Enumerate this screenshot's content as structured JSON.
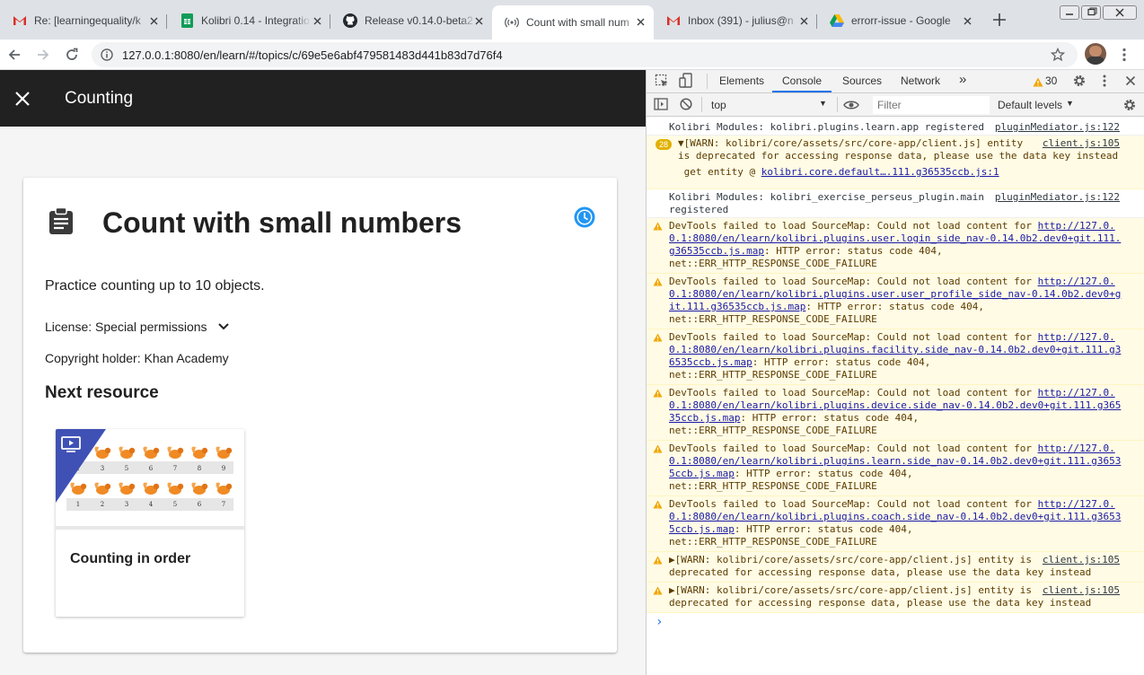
{
  "browser": {
    "tabs": [
      {
        "title": "Re: [learningequality/k",
        "icon": "gmail-icon"
      },
      {
        "title": "Kolibri 0.14 - Integratio",
        "icon": "sheets-icon"
      },
      {
        "title": "Release v0.14.0-beta2",
        "icon": "github-icon"
      },
      {
        "title": "Count with small num",
        "icon": "podcast-icon",
        "active": true
      },
      {
        "title": "Inbox (391) - julius@n",
        "icon": "gmail-icon"
      },
      {
        "title": "errorr-issue - Google",
        "icon": "drive-icon"
      }
    ],
    "url": "127.0.0.1:8080/en/learn/#/topics/c/69e5e6abf479581483d441b83d7d76f4"
  },
  "app": {
    "header_title": "Counting",
    "content_title": "Count with small numbers",
    "description": "Practice counting up to 10 objects.",
    "license": "License: Special permissions",
    "copyright": "Copyright holder: Khan Academy",
    "next_heading": "Next resource",
    "next_resource_title": "Counting in order",
    "thumb_row1": [
      "1",
      "3",
      "5",
      "6",
      "7",
      "8",
      "9"
    ],
    "thumb_row2": [
      "1",
      "2",
      "3",
      "4",
      "5",
      "6",
      "7"
    ],
    "accent": "#2196f3",
    "appbar_color": "#212121"
  },
  "devtools": {
    "tabs": [
      "Elements",
      "Console",
      "Sources",
      "Network"
    ],
    "more": "»",
    "warn_count": "30",
    "context": "top",
    "filter_placeholder": "Filter",
    "levels": "Default levels",
    "messages": [
      {
        "type": "log",
        "text": "Kolibri Modules: kolibri.plugins.learn.app registered",
        "src": "pluginMediator.js:122"
      },
      {
        "type": "warn",
        "badge": "28",
        "line1": "▼[WARN: kolibri/core/assets/src/core-app/client.js] entity",
        "line2": "is deprecated for accessing response data, please use the data key instead",
        "line3a": " get entity @ ",
        "line3b": "kolibri.core.default….111.g36535ccb.js:1",
        "src": "client.js:105"
      },
      {
        "type": "log",
        "text": "Kolibri Modules: kolibri_exercise_perseus_plugin.main\nregistered",
        "src": "pluginMediator.js:122"
      },
      {
        "type": "warn",
        "line1a": "DevTools failed to load SourceMap: Could not load content for ",
        "line1b": "http://127.0.",
        "line2": "0.1:8080/en/learn/kolibri.plugins.user.login_side_nav-0.14.0b2.dev0+git.111.",
        "line3a": "g36535ccb.js.map",
        "line3b": ": HTTP error: status code 404,",
        "line4": "net::ERR_HTTP_RESPONSE_CODE_FAILURE"
      },
      {
        "type": "warn",
        "line1a": "DevTools failed to load SourceMap: Could not load content for ",
        "line1b": "http://127.0.",
        "line2": "0.1:8080/en/learn/kolibri.plugins.user.user_profile_side_nav-0.14.0b2.dev0+g",
        "line3a": "it.111.g36535ccb.js.map",
        "line3b": ": HTTP error: status code 404,",
        "line4": "net::ERR_HTTP_RESPONSE_CODE_FAILURE"
      },
      {
        "type": "warn",
        "line1a": "DevTools failed to load SourceMap: Could not load content for ",
        "line1b": "http://127.0.",
        "line2": "0.1:8080/en/learn/kolibri.plugins.facility.side_nav-0.14.0b2.dev0+git.111.g3",
        "line3a": "6535ccb.js.map",
        "line3b": ": HTTP error: status code 404,",
        "line4": "net::ERR_HTTP_RESPONSE_CODE_FAILURE"
      },
      {
        "type": "warn",
        "line1a": "DevTools failed to load SourceMap: Could not load content for ",
        "line1b": "http://127.0.",
        "line2": "0.1:8080/en/learn/kolibri.plugins.device.side_nav-0.14.0b2.dev0+git.111.g365",
        "line3a": "35ccb.js.map",
        "line3b": ": HTTP error: status code 404,",
        "line4": "net::ERR_HTTP_RESPONSE_CODE_FAILURE"
      },
      {
        "type": "warn",
        "line1a": "DevTools failed to load SourceMap: Could not load content for ",
        "line1b": "http://127.0.",
        "line2": "0.1:8080/en/learn/kolibri.plugins.learn.side_nav-0.14.0b2.dev0+git.111.g3653",
        "line3a": "5ccb.js.map",
        "line3b": ": HTTP error: status code 404,",
        "line4": "net::ERR_HTTP_RESPONSE_CODE_FAILURE"
      },
      {
        "type": "warn",
        "line1a": "DevTools failed to load SourceMap: Could not load content for ",
        "line1b": "http://127.0.",
        "line2": "0.1:8080/en/learn/kolibri.plugins.coach.side_nav-0.14.0b2.dev0+git.111.g3653",
        "line3a": "5ccb.js.map",
        "line3b": ": HTTP error: status code 404,",
        "line4": "net::ERR_HTTP_RESPONSE_CODE_FAILURE"
      },
      {
        "type": "warn",
        "line1": "▶[WARN: kolibri/core/assets/src/core-app/client.js] entity is",
        "line2": "deprecated for accessing response data, please use the data key instead",
        "src": "client.js:105"
      },
      {
        "type": "warn",
        "line1": "▶[WARN: kolibri/core/assets/src/core-app/client.js] entity is",
        "line2": "deprecated for accessing response data, please use the data key instead",
        "src": "client.js:105"
      }
    ],
    "prompt": "›"
  }
}
